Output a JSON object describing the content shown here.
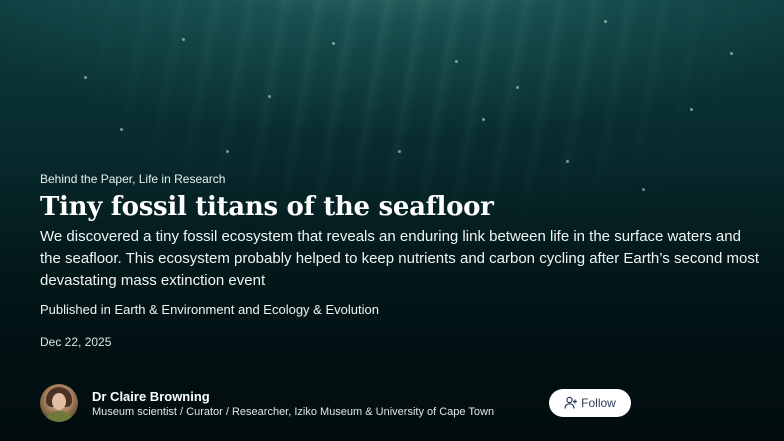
{
  "article": {
    "categories": "Behind the Paper, Life in Research",
    "title": "Tiny fossil titans of the seafloor",
    "summary": "We discovered a tiny fossil ecosystem that reveals an enduring link between life in the surface waters and the seafloor. This ecosystem probably helped to keep nutrients and carbon cycling after Earth’s second most devastating mass extinction event",
    "published": "Published in Earth & Environment and Ecology & Evolution",
    "date": "Dec 22, 2025"
  },
  "author": {
    "name": "Dr Claire Browning",
    "role": "Museum scientist / Curator / Researcher, Iziko Museum & University of Cape Town",
    "avatar_icon": "author-avatar-photo"
  },
  "follow_button": {
    "label": "Follow",
    "icon": "person-plus-icon",
    "text_color": "#2a3a5a",
    "background": "#ffffff"
  },
  "colors": {
    "background_deep": "#021213",
    "background_light": "#0d3a3c",
    "text": "#ffffff"
  }
}
